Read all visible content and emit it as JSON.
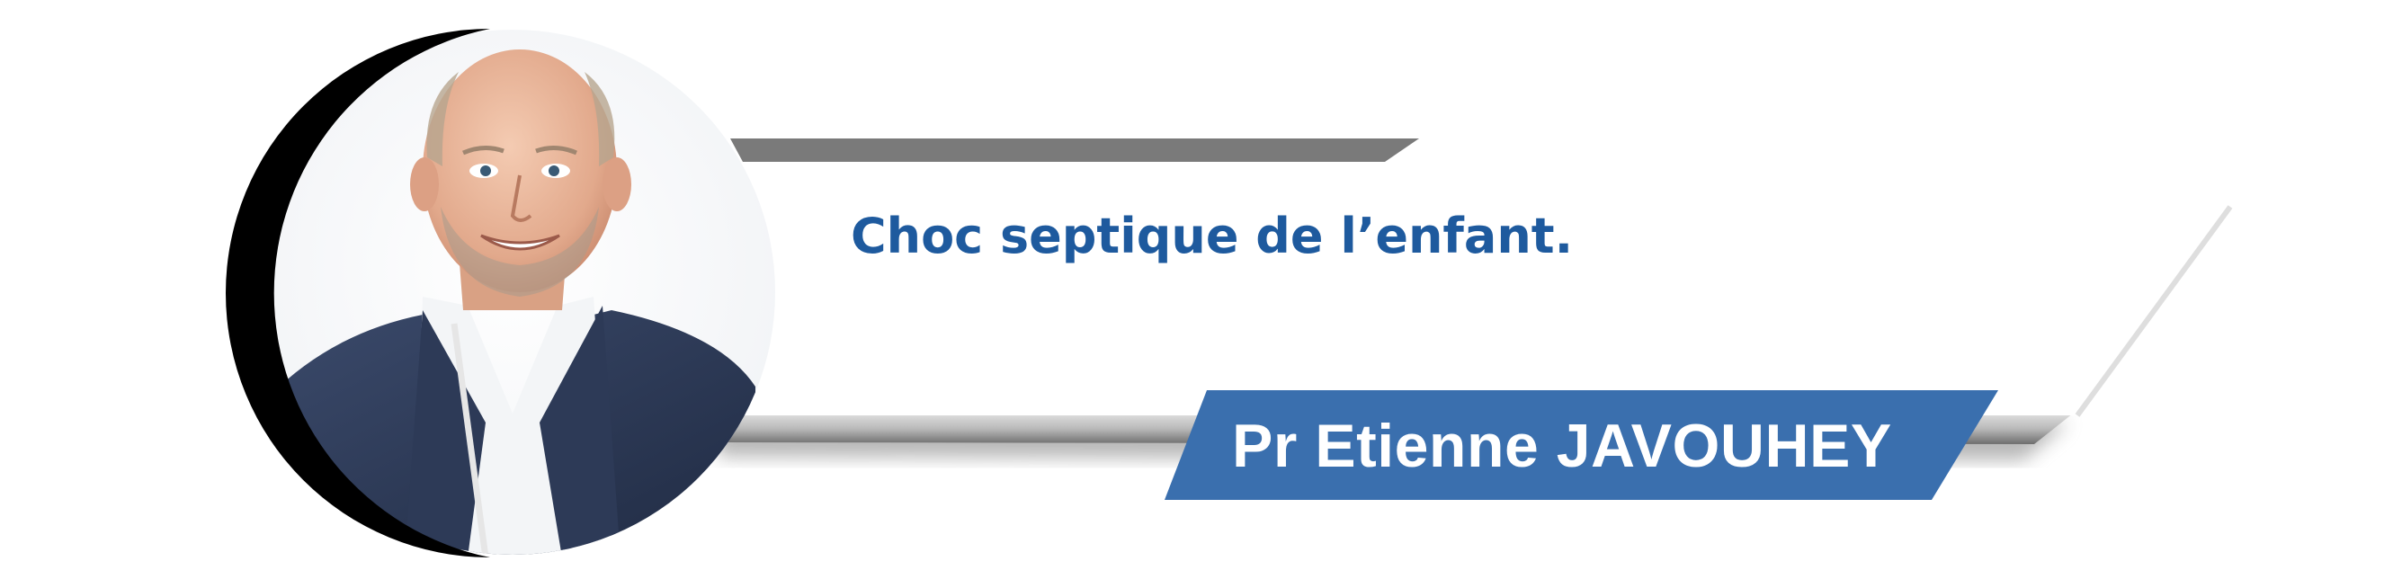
{
  "banner": {
    "title": "Choc septique de l’enfant.",
    "speaker_name": "Pr Etienne JAVOUHEY"
  },
  "icons": {
    "portrait": "portrait-photo"
  },
  "colors": {
    "title_blue": "#1e5a9e",
    "name_band_blue": "#3a6fae",
    "top_bar_gray": "#7a7a7a",
    "circle_ring": "#000000",
    "card_shadow": "#9a9a9a",
    "background": "#ffffff"
  }
}
